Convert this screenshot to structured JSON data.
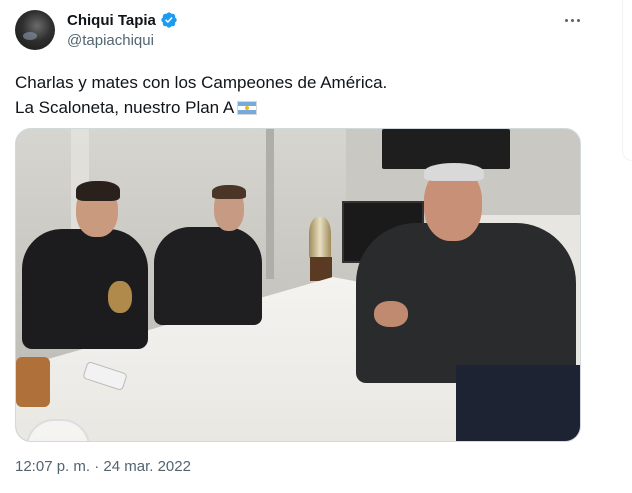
{
  "author": {
    "name": "Chiqui Tapia",
    "handle": "@tapiachiqui",
    "verified_icon": "verified-badge-icon"
  },
  "tweet": {
    "text_line_1": "Charlas y mates con los Campeones de América.",
    "text_line_2": "La Scaloneta, nuestro Plan A",
    "flag_icon": "argentina-flag-emoji",
    "timestamp": "12:07 p. m. · 24 mar. 2022"
  },
  "colors": {
    "verified_blue": "#1d9bf0",
    "secondary_text": "#536471",
    "primary_text": "#0f1419"
  }
}
